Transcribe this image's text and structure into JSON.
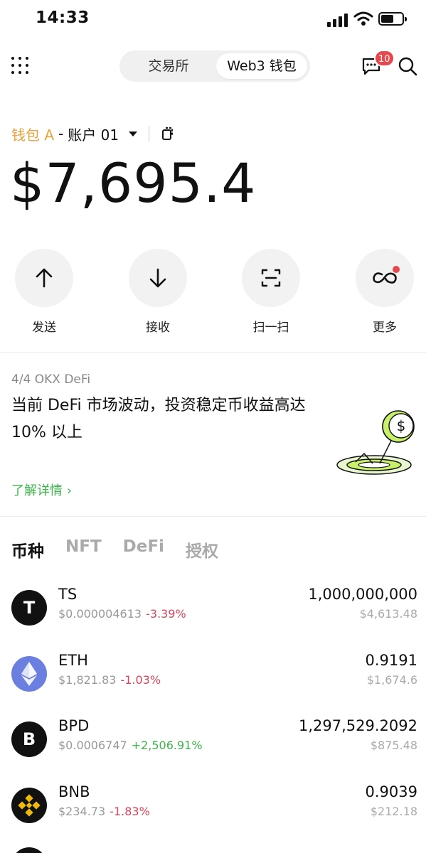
{
  "status": {
    "time": "14:33"
  },
  "header": {
    "segments": [
      "交易所",
      "Web3 钱包"
    ],
    "active_segment": "Web3 钱包",
    "message_badge": "10"
  },
  "wallet": {
    "name": "钱包 A",
    "separator": "-",
    "account": "账户 01",
    "balance": "$7,695.4"
  },
  "actions": [
    {
      "label": "发送",
      "icon": "arrow-up-icon"
    },
    {
      "label": "接收",
      "icon": "arrow-down-icon"
    },
    {
      "label": "扫一扫",
      "icon": "scan-icon"
    },
    {
      "label": "更多",
      "icon": "more-apps-icon"
    }
  ],
  "promo": {
    "subtitle": "4/4 OKX DeFi",
    "title": "当前 DeFi 市场波动，投资稳定币收益高达 10% 以上",
    "link": "了解详情 ›"
  },
  "tabs": [
    "币种",
    "NFT",
    "DeFi",
    "授权"
  ],
  "active_tab": "币种",
  "tokens": [
    {
      "symbol": "TS",
      "logo_text": "T",
      "price": "$0.000004613",
      "change": "-3.39%",
      "direction": "down",
      "amount": "1,000,000,000",
      "value": "$4,613.48"
    },
    {
      "symbol": "ETH",
      "logo_text": "",
      "price": "$1,821.83",
      "change": "-1.03%",
      "direction": "down",
      "amount": "0.9191",
      "value": "$1,674.6"
    },
    {
      "symbol": "BPD",
      "logo_text": "B",
      "price": "$0.0006747",
      "change": "+2,506.91%",
      "direction": "up",
      "amount": "1,297,529.2092",
      "value": "$875.48"
    },
    {
      "symbol": "BNB",
      "logo_text": "",
      "price": "$234.73",
      "change": "-1.83%",
      "direction": "down",
      "amount": "0.9039",
      "value": "$212.18"
    }
  ],
  "colors": {
    "wallet_name": "#e8a33d",
    "negative": "#d9455a",
    "positive": "#3db34a",
    "eth": "#6b7fe0",
    "bnb": "#f0b90b",
    "badge": "#e5484d"
  }
}
